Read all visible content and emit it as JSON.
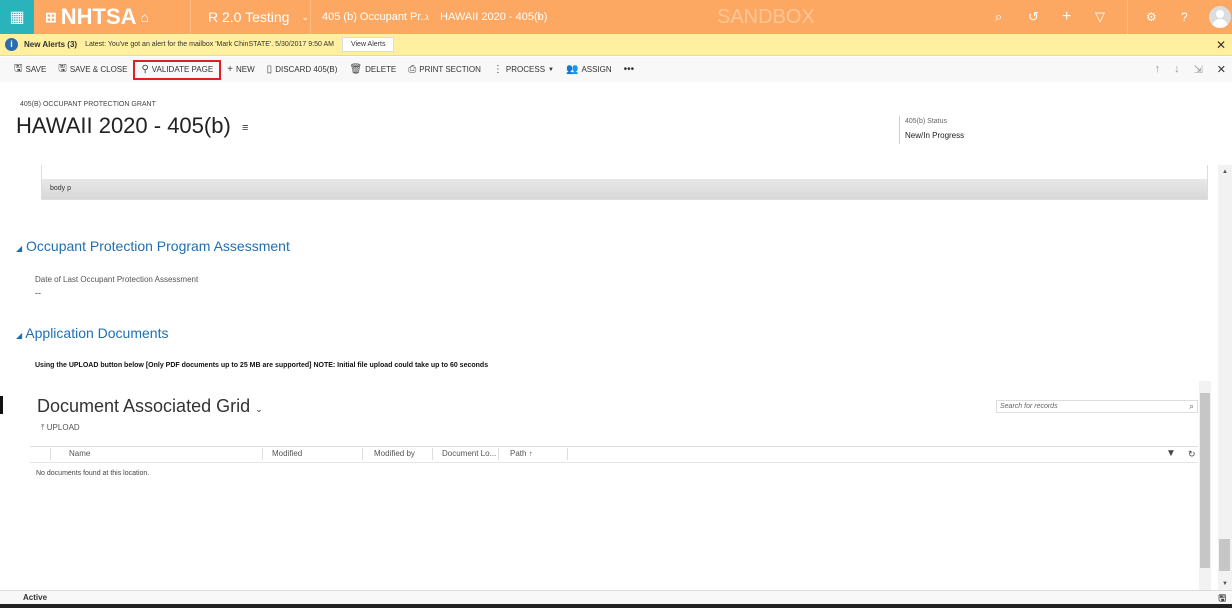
{
  "nav": {
    "logo": "NHTSA",
    "app": "R 2.0 Testing",
    "breadcrumb": [
      "405 (b) Occupant Pr...",
      "HAWAII 2020 - 405(b)"
    ],
    "environment": "SANDBOX"
  },
  "alert": {
    "title": "New Alerts (3)",
    "message": "Latest: You've got an alert for the mailbox 'Mark ChinSTATE'. 5/30/2017 9:50 AM",
    "button": "View Alerts"
  },
  "toolbar": {
    "items": [
      "SAVE",
      "SAVE & CLOSE",
      "VALIDATE PAGE",
      "NEW",
      "DISCARD 405(B)",
      "DELETE",
      "PRINT SECTION",
      "PROCESS",
      "ASSIGN"
    ],
    "more": "•••"
  },
  "record": {
    "entity": "405(B) OCCUPANT PROTECTION GRANT",
    "title": "HAWAII 2020 - 405(b)",
    "status_label": "405(b) Status",
    "status_value": "New/In Progress"
  },
  "editor": {
    "path": "body  p"
  },
  "sections": {
    "assessment": {
      "title": "Occupant Protection Program Assessment",
      "field_label": "Date of Last Occupant Protection Assessment",
      "field_value": "--"
    },
    "documents": {
      "title": "Application Documents",
      "note": "Using the UPLOAD button below [Only PDF documents up to 25 MB are supported] NOTE: Initial file upload could take up to 60 seconds"
    }
  },
  "grid": {
    "title": "Document Associated Grid",
    "upload": "UPLOAD",
    "search_placeholder": "Search for records",
    "columns": [
      "Name",
      "Modified",
      "Modified by",
      "Document Lo...",
      "Path ↑"
    ],
    "empty": "No documents found at this location."
  },
  "statusbar": {
    "state": "Active"
  }
}
